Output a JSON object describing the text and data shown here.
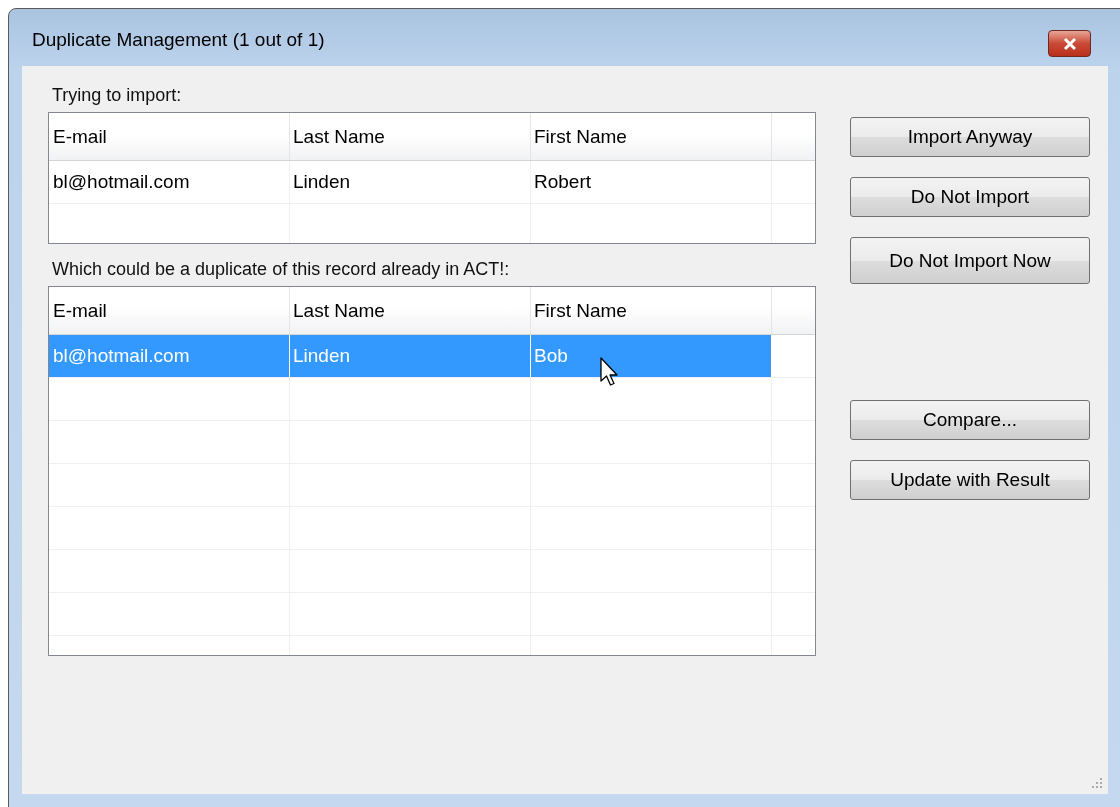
{
  "window": {
    "title": "Duplicate Management (1 out of 1)"
  },
  "import_section": {
    "label": "Trying to import:",
    "columns": [
      "E-mail",
      "Last Name",
      "First Name"
    ],
    "rows": [
      {
        "cells": [
          "bl@hotmail.com",
          "Linden",
          "Robert"
        ],
        "selected": false
      }
    ]
  },
  "existing_section": {
    "label": "Which could be a duplicate of this record already in ACT!:",
    "columns": [
      "E-mail",
      "Last Name",
      "First Name"
    ],
    "rows": [
      {
        "cells": [
          "bl@hotmail.com",
          "Linden",
          "Bob"
        ],
        "selected": true
      }
    ]
  },
  "buttons_top": [
    "Import Anyway",
    "Do Not Import",
    "Do Not Import Now"
  ],
  "buttons_bottom": [
    "Compare...",
    "Update with Result"
  ]
}
